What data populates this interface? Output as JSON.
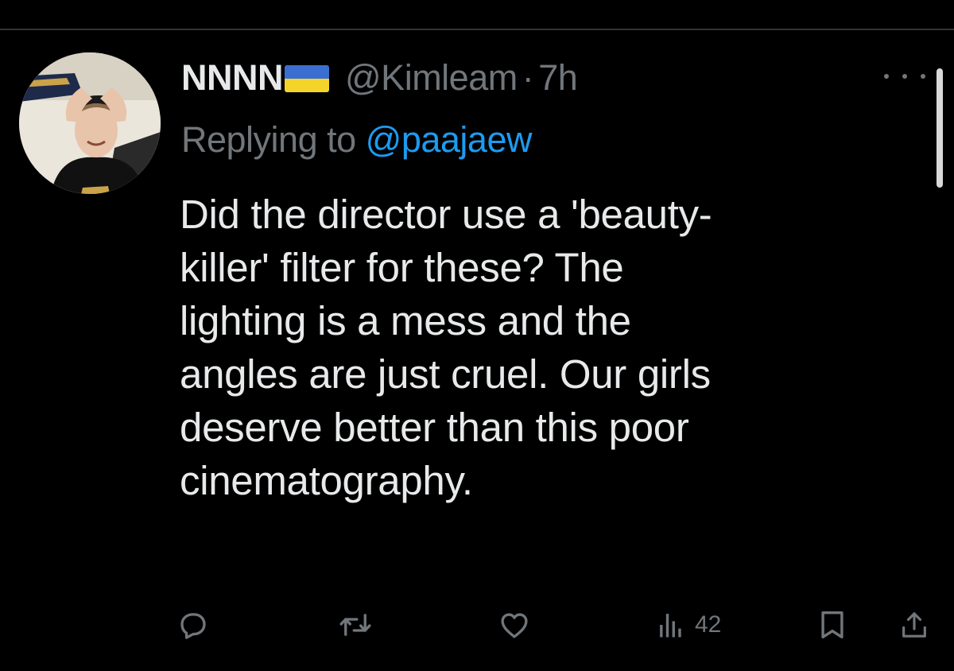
{
  "tweet": {
    "display_name": "NNNN",
    "flag": "ukraine-flag",
    "handle": "@Kimleam",
    "separator": "·",
    "time": "7h",
    "reply_prefix": "Replying to",
    "reply_to": "@paajaew",
    "text_lines": [
      "Did the director use a 'beauty-",
      "killer' filter for these? The",
      "lighting is a mess and the",
      "angles are just cruel. Our girls",
      "deserve better than this poor",
      "cinematography."
    ]
  },
  "actions": {
    "reply_icon": "reply-icon",
    "repost_icon": "repost-icon",
    "like_icon": "heart-icon",
    "views_icon": "views-icon",
    "views_count": "42",
    "bookmark_icon": "bookmark-icon",
    "share_icon": "share-icon"
  },
  "colors": {
    "background": "#000000",
    "text": "#e7e9ea",
    "muted": "#71767b",
    "link": "#1d9bf0",
    "flag_blue": "#3a6fd1",
    "flag_yellow": "#f5d42a"
  }
}
